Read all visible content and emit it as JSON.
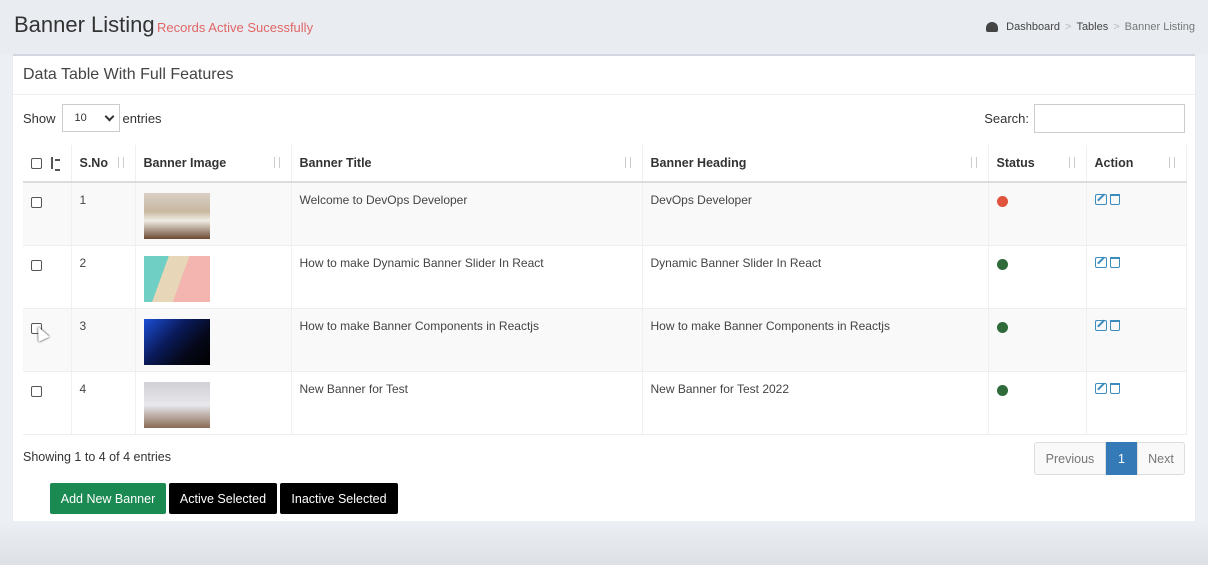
{
  "header": {
    "title": "Banner Listing",
    "message": "Records Active Sucessfully",
    "breadcrumb": [
      "Dashboard",
      ">",
      "Tables",
      ">",
      "Banner Listing"
    ]
  },
  "box": {
    "title": "Data Table With Full Features",
    "show_label": "Show",
    "length_value": "10",
    "entries_label": "entries",
    "search_label": "Search:",
    "search_value": ""
  },
  "table": {
    "columns": [
      "S.No",
      "Banner Image",
      "Banner Title",
      "Banner Heading",
      "Status",
      "Action"
    ],
    "rows": [
      {
        "sno": "1",
        "title": "Welcome to DevOps Developer",
        "heading": "DevOps Developer",
        "status_color": "#e0533c"
      },
      {
        "sno": "2",
        "title": "How to make Dynamic Banner Slider In React",
        "heading": "Dynamic Banner Slider In React",
        "status_color": "#2f6b3a"
      },
      {
        "sno": "3",
        "title": "How to make Banner Components in Reactjs",
        "heading": "How to make Banner Components in Reactjs",
        "status_color": "#2f6b3a"
      },
      {
        "sno": "4",
        "title": "New Banner for Test",
        "heading": "New Banner for Test 2022",
        "status_color": "#2f6b3a"
      }
    ]
  },
  "footer": {
    "info": "Showing 1 to 4 of 4 entries",
    "prev": "Previous",
    "current_page": "1",
    "next": "Next"
  },
  "buttons": {
    "add": "Add New Banner",
    "active": "Active Selected",
    "inactive": "Inactive Selected"
  },
  "icons": [
    "dashboard-icon",
    "edit-icon",
    "trash-icon",
    "sort-icon",
    "chevron-down-icon"
  ]
}
